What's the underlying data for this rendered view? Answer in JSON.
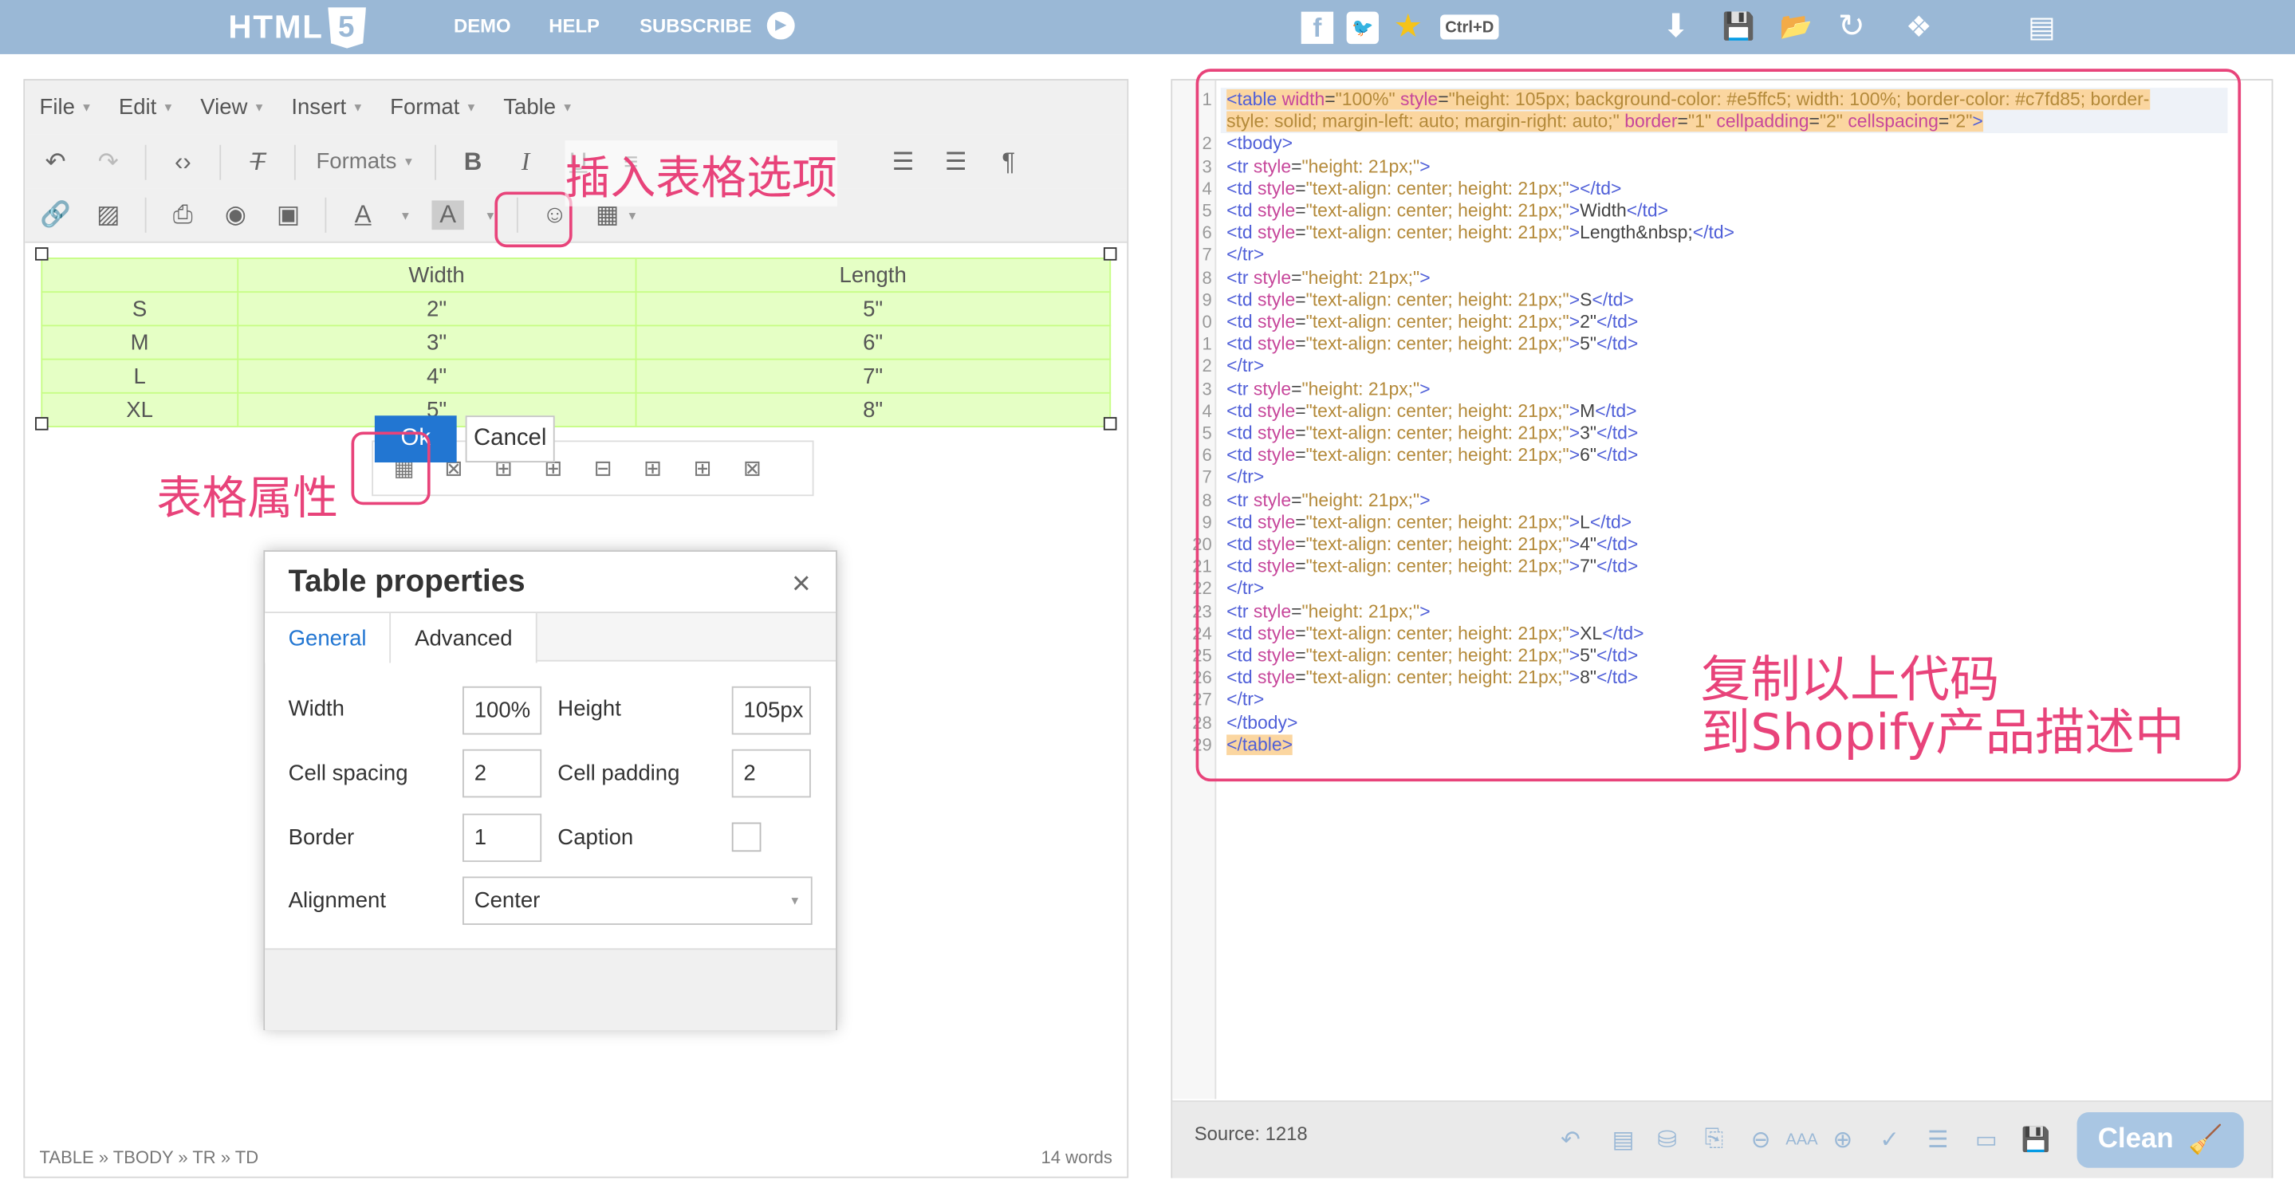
{
  "topbar": {
    "logo_text": "HTML",
    "logo_badge": "5",
    "nav": [
      "DEMO",
      "HELP",
      "SUBSCRIBE"
    ],
    "shortcut": "Ctrl+D",
    "icons": [
      "facebook-icon",
      "twitter-icon",
      "star-icon",
      "download-icon",
      "save-icon",
      "folder-open-icon",
      "refresh-icon",
      "dropbox-icon",
      "certificate-icon"
    ]
  },
  "editor": {
    "menus": [
      "File",
      "Edit",
      "View",
      "Insert",
      "Format",
      "Table"
    ],
    "formats_label": "Formats",
    "table_rows": [
      [
        "",
        "Width",
        "Length"
      ],
      [
        "S",
        "2\"",
        "5\""
      ],
      [
        "M",
        "3\"",
        "6\""
      ],
      [
        "L",
        "4\"",
        "7\""
      ],
      [
        "XL",
        "5\"",
        "8\""
      ]
    ],
    "status_path": "TABLE » TBODY » TR » TD",
    "word_count": "14 words"
  },
  "dialog": {
    "title": "Table properties",
    "close": "×",
    "tabs": [
      "General",
      "Advanced"
    ],
    "fields": {
      "width_label": "Width",
      "width_value": "100%",
      "height_label": "Height",
      "height_value": "105px",
      "cellspacing_label": "Cell spacing",
      "cellspacing_value": "2",
      "cellpadding_label": "Cell padding",
      "cellpadding_value": "2",
      "border_label": "Border",
      "border_value": "1",
      "caption_label": "Caption",
      "alignment_label": "Alignment",
      "alignment_value": "Center"
    },
    "ok": "Ok",
    "cancel": "Cancel"
  },
  "code": {
    "line_numbers": [
      "1",
      "2",
      "3",
      "4",
      "5",
      "6",
      "7",
      "8",
      "9",
      "0",
      "1",
      "2",
      "3",
      "4",
      "5",
      "6",
      "7",
      "8",
      "9",
      "20",
      "21",
      "22",
      "23",
      "24",
      "25",
      "26",
      "27",
      "28",
      "29"
    ],
    "source_label": "Source: 1218",
    "clean_label": "Clean"
  },
  "annotations": {
    "insert_table": "插入表格选项",
    "table_props": "表格属性",
    "copy_code_line1": "复制以上代码",
    "copy_code_line2": "到Shopify产品描述中"
  },
  "colors": {
    "accent": "#e8437a",
    "topbar": "#9ab8d6",
    "table_bg": "#e5ffc5",
    "table_border": "#c7fd85",
    "primary_btn": "#2276d2"
  }
}
